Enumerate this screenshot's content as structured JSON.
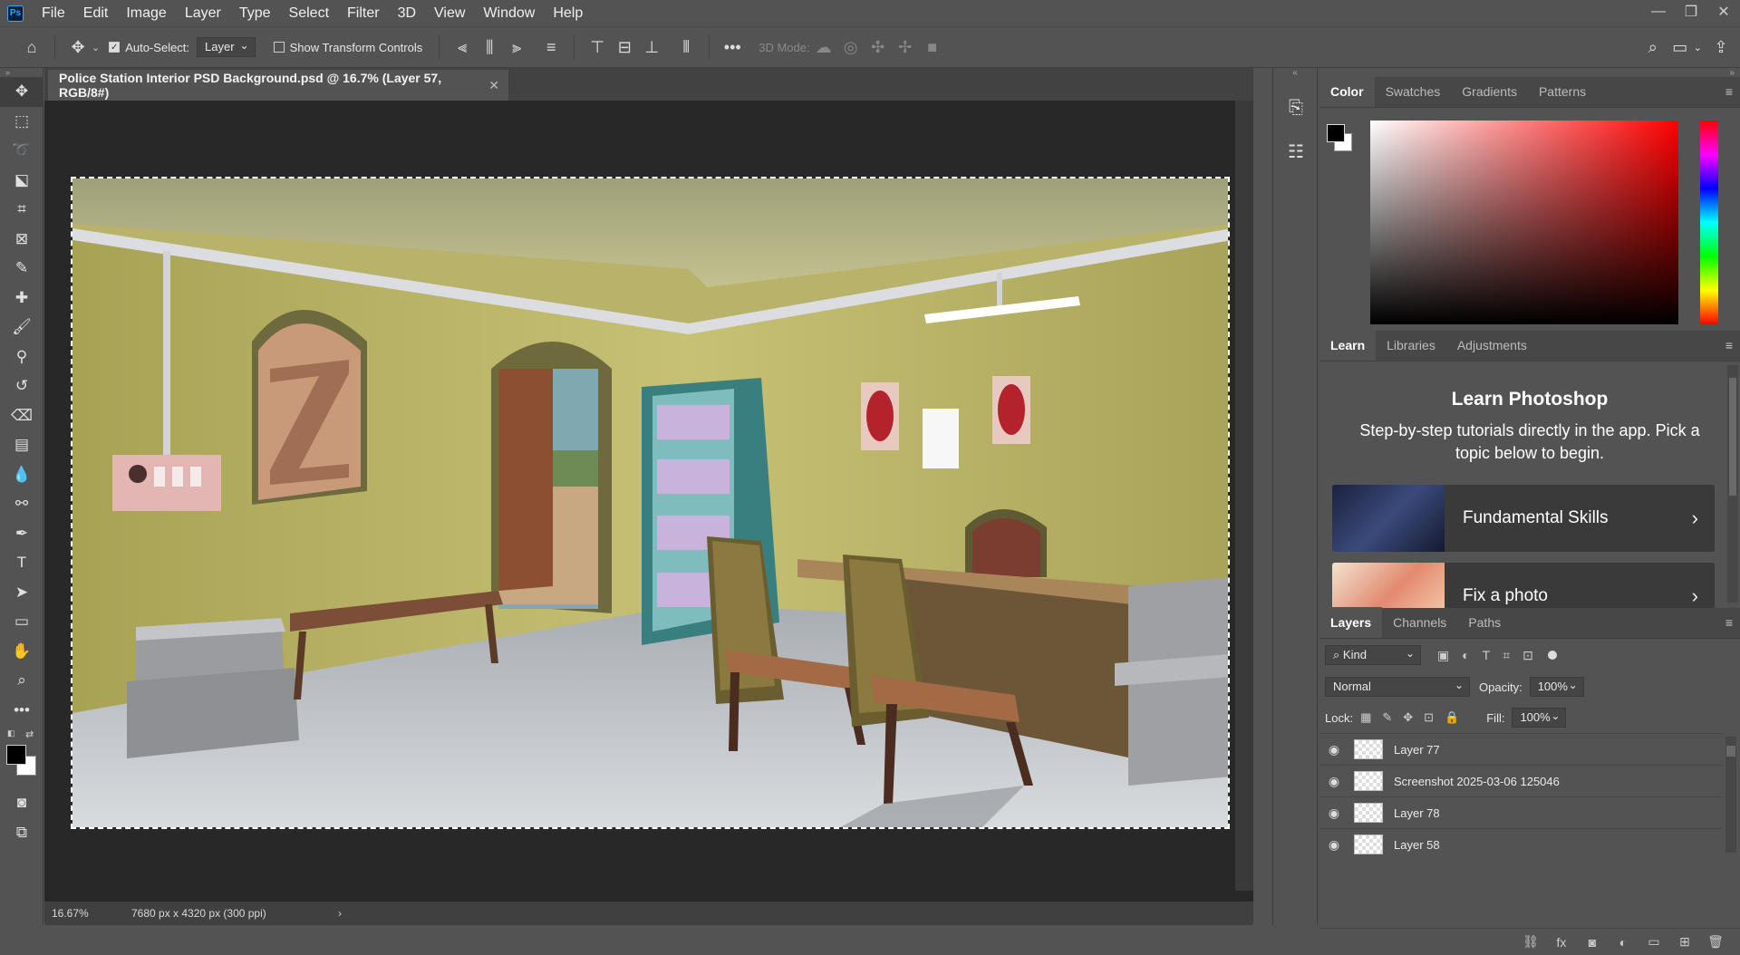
{
  "menu": [
    "File",
    "Edit",
    "Image",
    "Layer",
    "Type",
    "Select",
    "Filter",
    "3D",
    "View",
    "Window",
    "Help"
  ],
  "app_logo": "Ps",
  "options": {
    "auto_select_label": "Auto-Select:",
    "auto_select_value": "Layer",
    "show_transform_label": "Show Transform Controls",
    "mode_3d_label": "3D Mode:"
  },
  "document": {
    "tab_title": "Police Station Interior PSD Background.psd @ 16.7% (Layer 57, RGB/8#)",
    "zoom": "16.67%",
    "size": "7680 px x 4320 px (300 ppi)"
  },
  "color_panel": {
    "tabs": [
      "Color",
      "Swatches",
      "Gradients",
      "Patterns"
    ],
    "foreground": "#000000",
    "background": "#ffffff",
    "hue": "#ff0000"
  },
  "learn_panel": {
    "tabs": [
      "Learn",
      "Libraries",
      "Adjustments"
    ],
    "title": "Learn Photoshop",
    "description": "Step-by-step tutorials directly in the app. Pick a topic below to begin.",
    "cards": [
      {
        "label": "Fundamental Skills"
      },
      {
        "label": "Fix a photo"
      }
    ]
  },
  "layers_panel": {
    "tabs": [
      "Layers",
      "Channels",
      "Paths"
    ],
    "filter_kind": "Kind",
    "blend_mode": "Normal",
    "opacity_label": "Opacity:",
    "opacity": "100%",
    "lock_label": "Lock:",
    "fill_label": "Fill:",
    "fill": "100%",
    "layers": [
      "Layer 77",
      "Screenshot 2025-03-06 125046",
      "Layer 78",
      "Layer 58"
    ]
  }
}
